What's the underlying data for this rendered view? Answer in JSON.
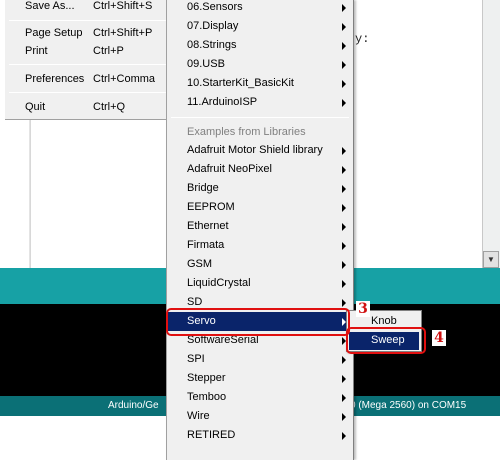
{
  "editor": {
    "code_fragment": "y:"
  },
  "status_bar": {
    "board_left": "Arduino/Ge",
    "board_right": "0 (Mega 2560) on COM15"
  },
  "file_menu": {
    "items": [
      {
        "label": "Save As...",
        "shortcut": "Ctrl+Shift+S"
      },
      {
        "label": "Page Setup",
        "shortcut": "Ctrl+Shift+P"
      },
      {
        "label": "Print",
        "shortcut": "Ctrl+P"
      },
      {
        "label": "Preferences",
        "shortcut": "Ctrl+Comma"
      },
      {
        "label": "Quit",
        "shortcut": "Ctrl+Q"
      }
    ]
  },
  "examples_menu": {
    "builtin": [
      "06.Sensors",
      "07.Display",
      "08.Strings",
      "09.USB",
      "10.StarterKit_BasicKit",
      "11.ArduinoISP"
    ],
    "libraries_header": "Examples from Libraries",
    "libraries": [
      "Adafruit Motor Shield library",
      "Adafruit NeoPixel",
      "Bridge",
      "EEPROM",
      "Ethernet",
      "Firmata",
      "GSM",
      "LiquidCrystal",
      "SD",
      "Servo",
      "SoftwareSerial",
      "SPI",
      "Stepper",
      "Temboo",
      "Wire",
      "RETIRED"
    ],
    "selected": "Servo"
  },
  "servo_menu": {
    "items": [
      "Knob",
      "Sweep"
    ],
    "selected": "Sweep"
  },
  "annotations": {
    "step_3": "3",
    "step_4": "4"
  },
  "colors": {
    "selection": "#0a246a",
    "highlight_annotation": "#e01010",
    "ide_teal": "#17a1a5",
    "ide_status": "#0b7076"
  }
}
